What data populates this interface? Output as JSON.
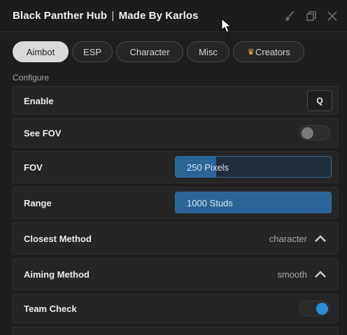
{
  "window": {
    "title_left": "Black Panther Hub",
    "title_sep": "|",
    "title_right": "Made By Karlos",
    "icons": [
      "brush-icon",
      "restore-icon",
      "close-icon"
    ]
  },
  "tabs": [
    {
      "label": "Aimbot",
      "active": true
    },
    {
      "label": "ESP",
      "active": false
    },
    {
      "label": "Character",
      "active": false
    },
    {
      "label": "Misc",
      "active": false
    },
    {
      "label": "Creators",
      "icon": "crown-icon",
      "active": false
    }
  ],
  "section": {
    "label": "Configure"
  },
  "settings": {
    "enable": {
      "label": "Enable",
      "key": "Q"
    },
    "see_fov": {
      "label": "See FOV",
      "toggle": false
    },
    "fov": {
      "label": "FOV",
      "value_text": "250 Pixels",
      "fill": 0.26
    },
    "range": {
      "label": "Range",
      "value_text": "1000 Studs",
      "fill": 1.0
    },
    "closest_method": {
      "label": "Closest Method",
      "value": "character"
    },
    "aiming_method": {
      "label": "Aiming Method",
      "value": "smooth"
    },
    "team_check": {
      "label": "Team Check",
      "toggle": true
    }
  },
  "colors": {
    "accent": "#2b8ed6",
    "slider_fill": "#2a6598",
    "active_tab": "#d9d9d9",
    "crown": "#e3b23c"
  }
}
